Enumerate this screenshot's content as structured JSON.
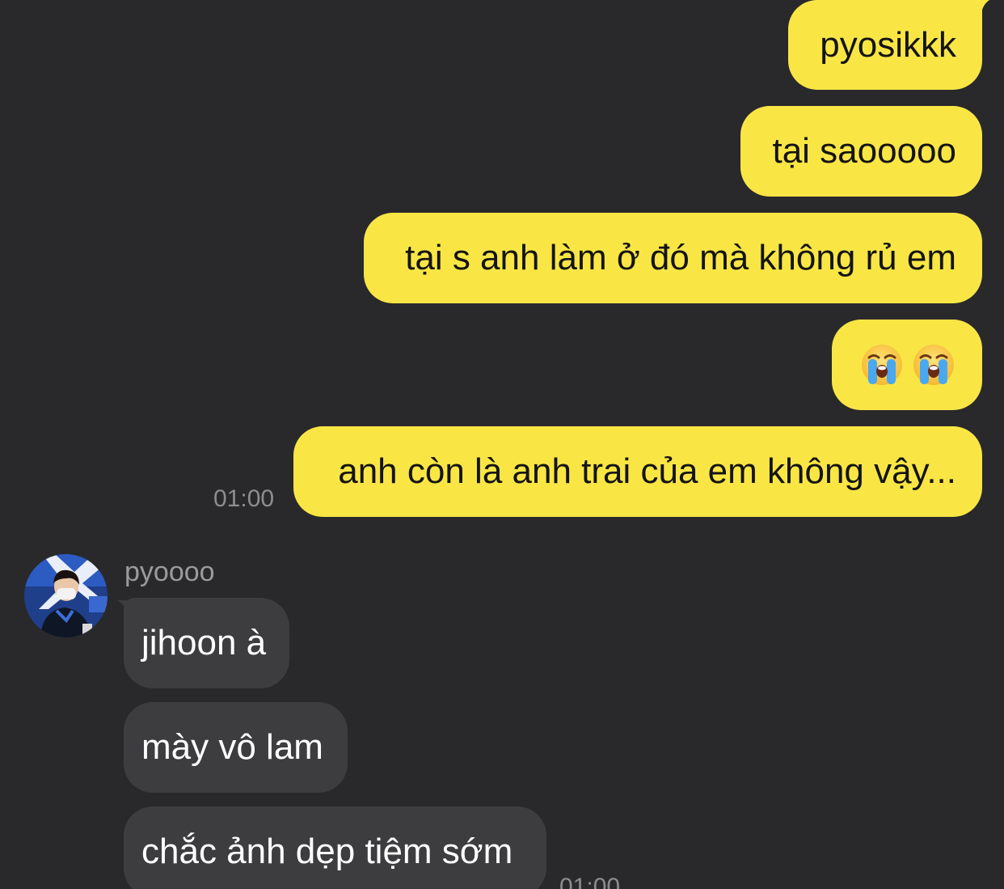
{
  "outgoing_messages": [
    {
      "text": "pyosikkk"
    },
    {
      "text": "tại saooooo"
    },
    {
      "text": "tại s anh làm ở đó mà không rủ em"
    },
    {
      "emoji": [
        "loudly-crying-face",
        "loudly-crying-face"
      ]
    },
    {
      "text": "anh còn là anh trai của em không vậy..."
    }
  ],
  "outgoing_timestamp": "01:00",
  "incoming": {
    "sender_name": "pyoooo",
    "messages": [
      {
        "text": "jihoon à"
      },
      {
        "text": "mày vô lam"
      },
      {
        "text": "chắc ảnh dẹp tiệm sớm"
      }
    ],
    "timestamp": "01:00"
  },
  "colors": {
    "background": "#29292b",
    "outgoing_bubble": "#f9e645",
    "incoming_bubble": "#3d3d40",
    "timestamp": "#8d8d90"
  }
}
